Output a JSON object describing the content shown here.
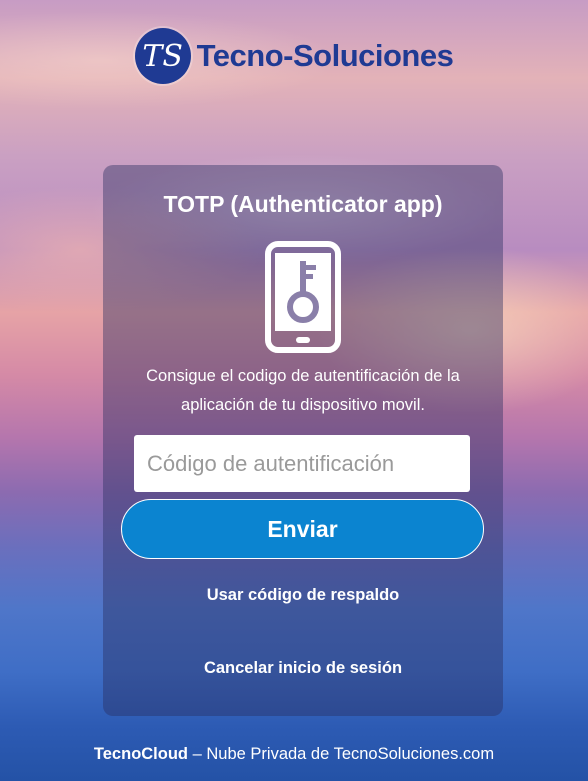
{
  "brand": {
    "logo_monogram": "TS",
    "name": "Tecno-Soluciones"
  },
  "card": {
    "title": "TOTP (Authenticator app)",
    "icon": "phone-key-icon",
    "description_line1": "Consigue el codigo de autentificación de la",
    "description_line2": "aplicación de tu dispositivo movil.",
    "code_input": {
      "value": "",
      "placeholder": "Código de autentificación"
    },
    "send_label": "Enviar",
    "backup_link": "Usar código de respaldo",
    "cancel_link": "Cancelar inicio de sesión"
  },
  "footer": {
    "product": "TecnoCloud",
    "separator": " – ",
    "tagline": "Nube Privada de TecnoSoluciones.com"
  },
  "colors": {
    "brand_navy": "#1f3a93",
    "button_blue": "#0b84d0",
    "card_overlay": "rgba(40,45,95,0.42)"
  }
}
